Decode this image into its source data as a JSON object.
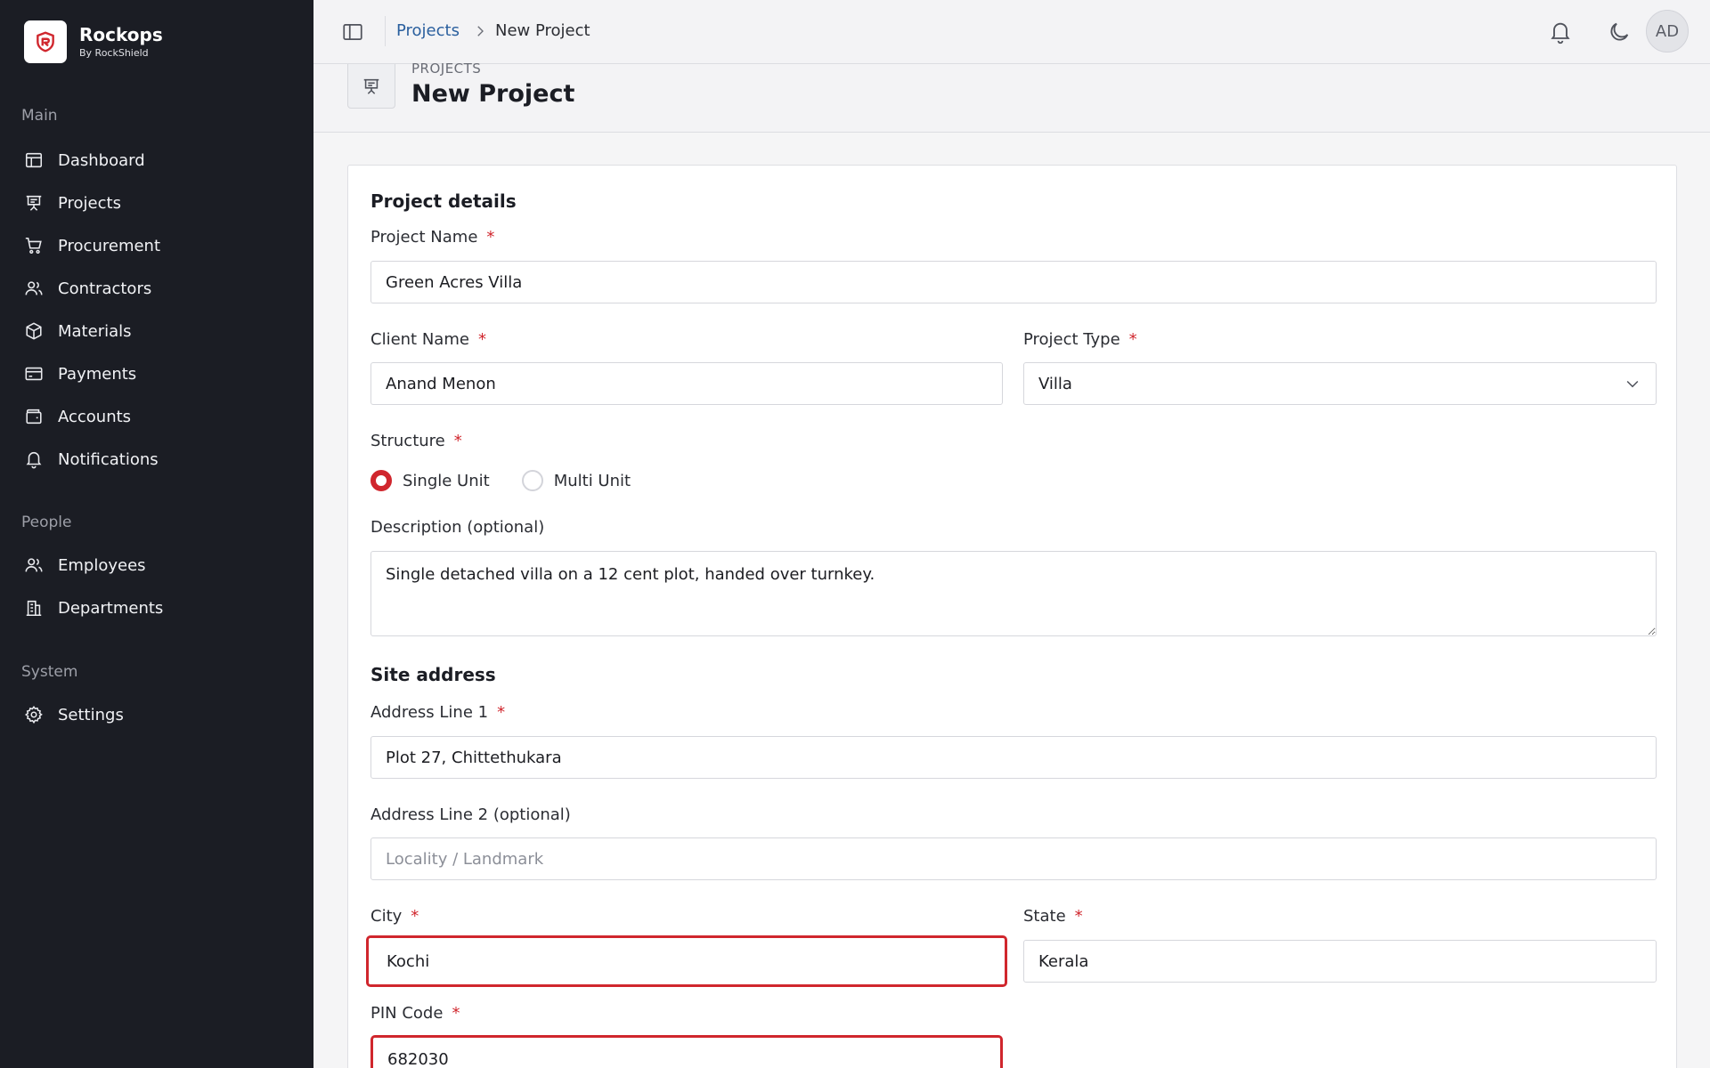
{
  "brand": {
    "name": "Rockops",
    "sub": "By RockShield"
  },
  "sidebar": {
    "sections": [
      {
        "label": "Main"
      },
      {
        "label": "People"
      },
      {
        "label": "System"
      }
    ],
    "items": [
      {
        "label": "Dashboard",
        "icon": "dashboard-icon"
      },
      {
        "label": "Projects",
        "icon": "projects-icon"
      },
      {
        "label": "Procurement",
        "icon": "cart-icon"
      },
      {
        "label": "Contractors",
        "icon": "users-icon"
      },
      {
        "label": "Materials",
        "icon": "box-icon"
      },
      {
        "label": "Payments",
        "icon": "card-icon"
      },
      {
        "label": "Accounts",
        "icon": "wallet-icon"
      },
      {
        "label": "Notifications",
        "icon": "bell-icon"
      },
      {
        "label": "Employees",
        "icon": "users-icon"
      },
      {
        "label": "Departments",
        "icon": "building-icon"
      },
      {
        "label": "Settings",
        "icon": "gear-icon"
      }
    ]
  },
  "topbar": {
    "breadcrumb": {
      "parent": "Projects",
      "current": "New Project"
    },
    "avatar_initials": "AD"
  },
  "page": {
    "eyebrow": "PROJECTS",
    "title": "New Project"
  },
  "form": {
    "project_details_title": "Project details",
    "project_name": {
      "label": "Project Name",
      "value": "Green Acres Villa",
      "required": "*"
    },
    "client_name": {
      "label": "Client Name",
      "value": "Anand Menon",
      "required": "*"
    },
    "project_type": {
      "label": "Project Type",
      "value": "Villa",
      "required": "*"
    },
    "structure": {
      "label": "Structure",
      "required": "*",
      "options": [
        "Single Unit",
        "Multi Unit"
      ],
      "selected": "Single Unit"
    },
    "description": {
      "label": "Description (optional)",
      "value": "Single detached villa on a 12 cent plot, handed over turnkey."
    },
    "site_address_title": "Site address",
    "address1": {
      "label": "Address Line 1",
      "value": "Plot 27, Chittethukara",
      "required": "*"
    },
    "address2": {
      "label": "Address Line 2 (optional)",
      "value": "",
      "placeholder": "Locality / Landmark"
    },
    "city": {
      "label": "City",
      "value": "Kochi",
      "required": "*"
    },
    "state": {
      "label": "State",
      "value": "Kerala",
      "required": "*"
    },
    "pin": {
      "label": "PIN Code",
      "value": "682030",
      "required": "*"
    }
  },
  "colors": {
    "sidebar_bg": "#1b1d24",
    "accent": "#d0262d",
    "link": "#2a5f9e"
  }
}
